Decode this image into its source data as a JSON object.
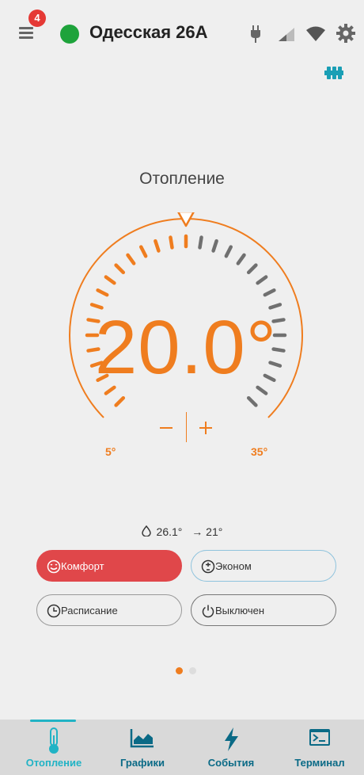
{
  "header": {
    "notification_count": "4",
    "device_name": "Одесская 26А"
  },
  "thermostat": {
    "title": "Отопление",
    "setpoint": "20.0°",
    "min_label": "5°",
    "max_label": "35°",
    "setpoint_value": 20,
    "min_value": 5,
    "max_value": 35
  },
  "readings": {
    "current_temp": "26.1°",
    "target": "→ 21°"
  },
  "modes": {
    "comfort": "Комфорт",
    "econom": "Эконом",
    "schedule": "Расписание",
    "off": "Выключен"
  },
  "nav": {
    "heating": "Отопление",
    "charts": "Графики",
    "events": "События",
    "terminal": "Терминал"
  },
  "colors": {
    "accent": "#ef7d1f",
    "status_online": "#1ea33b",
    "comfort_active": "#e0474a",
    "nav_text": "#0a6a86",
    "nav_active": "#21b3c5"
  },
  "icons": [
    "menu-icon",
    "plug-icon",
    "signal-icon",
    "wifi-icon",
    "gear-icon",
    "radiator-icon",
    "drop-icon",
    "smile-icon",
    "econom-icon",
    "clock-icon",
    "power-icon",
    "thermometer-icon",
    "chart-icon",
    "lightning-icon",
    "terminal-icon"
  ]
}
